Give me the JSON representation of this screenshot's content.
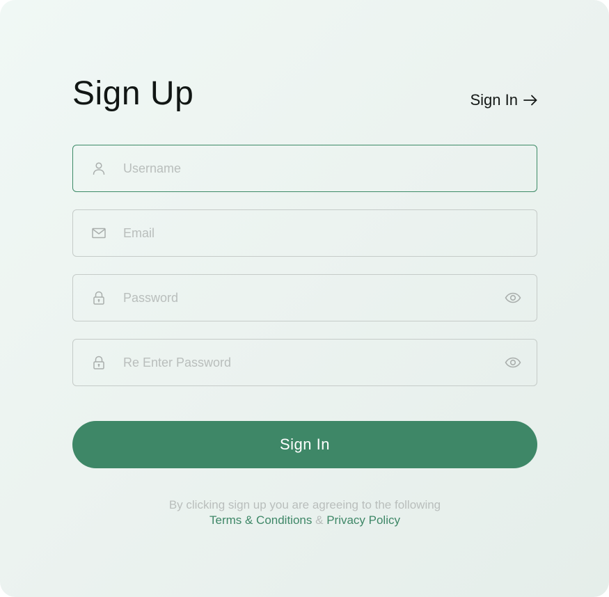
{
  "form": {
    "title": "Sign Up",
    "alt_link": {
      "label": "Sign In",
      "icon": "arrow-right-icon"
    },
    "fields": {
      "username": {
        "placeholder": "Username",
        "value": "",
        "icon": "user-icon"
      },
      "email": {
        "placeholder": "Email",
        "value": "",
        "icon": "mail-icon"
      },
      "password": {
        "placeholder": "Password",
        "value": "",
        "icon": "lock-icon",
        "toggle_icon": "eye-icon"
      },
      "confirm_password": {
        "placeholder": "Re Enter Password",
        "value": "",
        "icon": "lock-icon",
        "toggle_icon": "eye-icon"
      }
    },
    "submit_label": "Sign In",
    "legal": {
      "prefix": "By clicking sign up you are agreeing to the following",
      "terms": "Terms & Conditions",
      "separator": "&",
      "privacy": "Privacy Policy"
    }
  },
  "colors": {
    "accent": "#3e8767",
    "focus_border": "#3c8a66",
    "field_border": "#c5cbc8",
    "placeholder": "#b9bebc",
    "title": "#111614",
    "background_start": "#f0f8f5",
    "background_end": "#e5eeea"
  }
}
